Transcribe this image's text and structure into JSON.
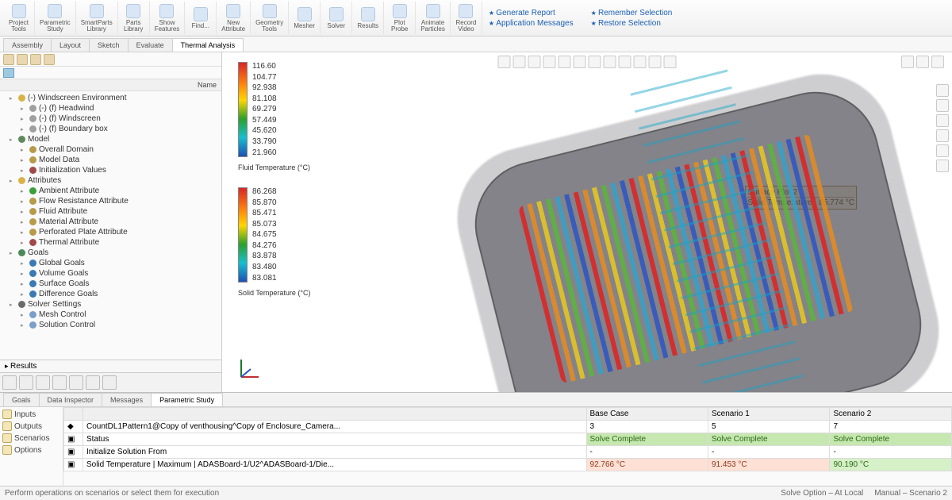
{
  "ribbon": {
    "buttons": [
      {
        "k": "project_tools",
        "label": "Project\nTools"
      },
      {
        "k": "parametric_study",
        "label": "Parametric\nStudy"
      },
      {
        "k": "smartparts",
        "label": "SmartParts\nLibrary"
      },
      {
        "k": "parts_lib",
        "label": "Parts\nLibrary"
      },
      {
        "k": "show_feat",
        "label": "Show\nFeatures"
      },
      {
        "k": "find",
        "label": "Find..."
      },
      {
        "k": "new_attr",
        "label": "New\nAttribute"
      },
      {
        "k": "geom_tools",
        "label": "Geometry\nTools"
      },
      {
        "k": "mesher",
        "label": "Mesher"
      },
      {
        "k": "solver",
        "label": "Solver"
      },
      {
        "k": "results",
        "label": "Results"
      },
      {
        "k": "probe",
        "label": "Plot\nProbe"
      },
      {
        "k": "anim_part",
        "label": "Animate\nParticles"
      },
      {
        "k": "rec_video",
        "label": "Record\nVideo"
      }
    ],
    "links_col1": [
      "Generate Report",
      "Application Messages"
    ],
    "links_col2": [
      "Remember Selection",
      "Restore Selection"
    ]
  },
  "top_tabs": [
    "Assembly",
    "Layout",
    "Sketch",
    "Evaluate",
    "Thermal Analysis"
  ],
  "top_tab_active": 4,
  "tree": {
    "header": "Name",
    "items": [
      {
        "lvl": 1,
        "txt": "(-) Windscreen Environment",
        "ic": "#d9b34a"
      },
      {
        "lvl": 2,
        "txt": "(-) (f) Headwind",
        "ic": "#a0a0a0"
      },
      {
        "lvl": 2,
        "txt": "(-) (f) Windscreen",
        "ic": "#a0a0a0"
      },
      {
        "lvl": 2,
        "txt": "(-) (f) Boundary box",
        "ic": "#a0a0a0"
      },
      {
        "lvl": 1,
        "txt": "Model",
        "ic": "#5d8a5a"
      },
      {
        "lvl": 2,
        "txt": "Overall Domain",
        "ic": "#b79a4a"
      },
      {
        "lvl": 2,
        "txt": "Model Data",
        "ic": "#b79a4a"
      },
      {
        "lvl": 2,
        "txt": "Initialization Values",
        "ic": "#a24a4a"
      },
      {
        "lvl": 1,
        "txt": "Attributes",
        "ic": "#d9b34a"
      },
      {
        "lvl": 2,
        "txt": "Ambient Attribute",
        "ic": "#3aa03a"
      },
      {
        "lvl": 2,
        "txt": "Flow Resistance Attribute",
        "ic": "#b79a4a"
      },
      {
        "lvl": 2,
        "txt": "Fluid Attribute",
        "ic": "#b79a4a"
      },
      {
        "lvl": 2,
        "txt": "Material Attribute",
        "ic": "#b79a4a"
      },
      {
        "lvl": 2,
        "txt": "Perforated Plate Attribute",
        "ic": "#b79a4a"
      },
      {
        "lvl": 2,
        "txt": "Thermal Attribute",
        "ic": "#a24a4a"
      },
      {
        "lvl": 1,
        "txt": "Goals",
        "ic": "#4a8a5a"
      },
      {
        "lvl": 2,
        "txt": "Global Goals",
        "ic": "#3a7ab5"
      },
      {
        "lvl": 2,
        "txt": "Volume Goals",
        "ic": "#3a7ab5"
      },
      {
        "lvl": 2,
        "txt": "Surface Goals",
        "ic": "#3a7ab5"
      },
      {
        "lvl": 2,
        "txt": "Difference Goals",
        "ic": "#3a7ab5"
      },
      {
        "lvl": 1,
        "txt": "Solver Settings",
        "ic": "#6a6a6a"
      },
      {
        "lvl": 2,
        "txt": "Mesh Control",
        "ic": "#7aa0c9"
      },
      {
        "lvl": 2,
        "txt": "Solution Control",
        "ic": "#7aa0c9"
      }
    ],
    "results_row": "Results"
  },
  "legend_fluid": {
    "vals": [
      "116.60",
      "104.77",
      "92.938",
      "81.108",
      "69.279",
      "57.449",
      "45.620",
      "33.790",
      "21.960"
    ],
    "title": "Fluid Temperature (°C)"
  },
  "legend_solid": {
    "vals": [
      "86.268",
      "85.870",
      "85.471",
      "85.073",
      "84.675",
      "84.276",
      "83.878",
      "83.480",
      "83.081"
    ],
    "title": "Solid Temperature (°C)"
  },
  "probe": {
    "title": "Surface Plot 2",
    "field": "Solid Temperature",
    "value": "85.774 °C"
  },
  "bottom": {
    "tabs": [
      "Goals",
      "Data Inspector",
      "Messages",
      "Parametric Study"
    ],
    "active": 3,
    "side": [
      "Inputs",
      "Outputs",
      "Scenarios",
      "Options"
    ],
    "cols": [
      "",
      "",
      "Base Case",
      "Scenario 1",
      "Scenario 2"
    ],
    "row_count": {
      "label": "CountDL1Pattern1@Copy of venthousing^Copy of Enclosure_Camera...",
      "vals": [
        "3",
        "5",
        "7"
      ]
    },
    "row_status": {
      "label": "Status",
      "vals": [
        "Solve Complete",
        "Solve Complete",
        "Solve Complete"
      ]
    },
    "row_init": {
      "label": "Initialize Solution From",
      "vals": [
        "-",
        "-",
        "-"
      ]
    },
    "row_temp": {
      "label": "Solid Temperature | Maximum | ADASBoard-1/U2^ADASBoard-1/Die...",
      "vals": [
        "92.766 °C",
        "91.453 °C",
        "90.190 °C"
      ]
    }
  },
  "status_bar": {
    "left": "Perform operations on scenarios or select them for execution",
    "right1": "Solve Option – At Local",
    "right2": "Manual – Scenario 2"
  }
}
